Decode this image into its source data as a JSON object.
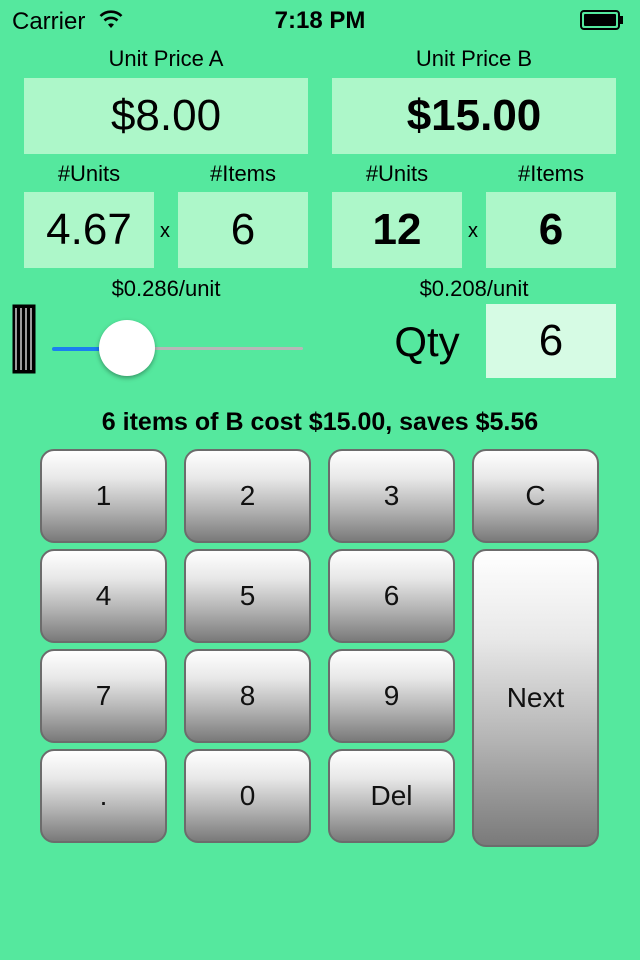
{
  "status_bar": {
    "carrier": "Carrier",
    "time": "7:18 PM"
  },
  "item_a": {
    "header": "Unit Price A",
    "price": "$8.00",
    "units_label": "#Units",
    "items_label": "#Items",
    "units": "4.67",
    "times": "x",
    "items": "6",
    "per_unit": "$0.286/unit"
  },
  "item_b": {
    "header": "Unit Price B",
    "price": "$15.00",
    "units_label": "#Units",
    "items_label": "#Items",
    "units": "12",
    "times": "x",
    "items": "6",
    "per_unit": "$0.208/unit"
  },
  "quantity": {
    "label": "Qty",
    "value": "6",
    "slider_fraction": 0.3
  },
  "summary": "6 items of B cost $15.00, saves $5.56",
  "keypad": {
    "k1": "1",
    "k2": "2",
    "k3": "3",
    "clear": "C",
    "k4": "4",
    "k5": "5",
    "k6": "6",
    "k7": "7",
    "k8": "8",
    "k9": "9",
    "next": "Next",
    "dot": ".",
    "k0": "0",
    "del": "Del"
  }
}
